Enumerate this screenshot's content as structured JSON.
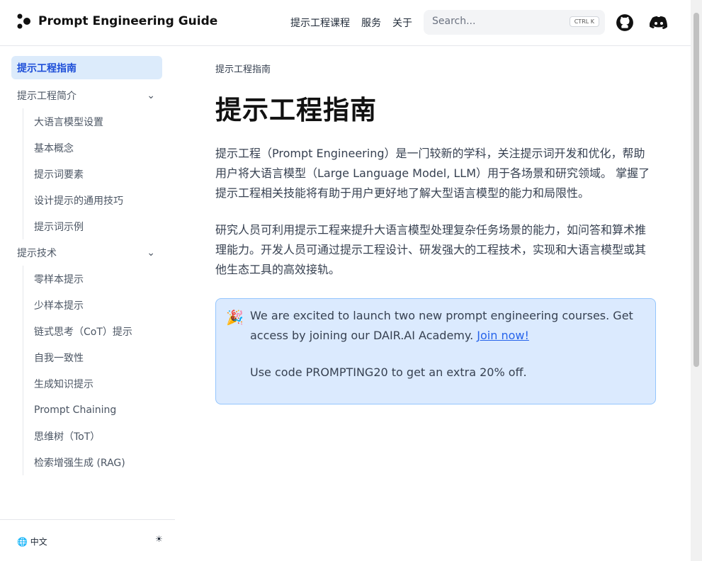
{
  "header": {
    "title": "Prompt Engineering Guide",
    "nav": [
      "提示工程课程",
      "服务",
      "关于"
    ],
    "search_placeholder": "Search...",
    "search_kbd": "CTRL K"
  },
  "sidebar": {
    "items": [
      {
        "label": "提示工程指南",
        "type": "active"
      },
      {
        "label": "提示工程简介",
        "type": "section"
      },
      {
        "label": "大语言模型设置",
        "type": "sub"
      },
      {
        "label": "基本概念",
        "type": "sub"
      },
      {
        "label": "提示词要素",
        "type": "sub"
      },
      {
        "label": "设计提示的通用技巧",
        "type": "sub"
      },
      {
        "label": "提示词示例",
        "type": "sub"
      },
      {
        "label": "提示技术",
        "type": "section"
      },
      {
        "label": "零样本提示",
        "type": "sub"
      },
      {
        "label": "少样本提示",
        "type": "sub"
      },
      {
        "label": "链式思考（CoT）提示",
        "type": "sub"
      },
      {
        "label": "自我一致性",
        "type": "sub"
      },
      {
        "label": "生成知识提示",
        "type": "sub"
      },
      {
        "label": "Prompt Chaining",
        "type": "sub"
      },
      {
        "label": "思维树（ToT）",
        "type": "sub"
      },
      {
        "label": "检索增强生成 (RAG)",
        "type": "sub"
      }
    ],
    "language": "中文"
  },
  "main": {
    "breadcrumb": "提示工程指南",
    "title": "提示工程指南",
    "paragraphs": [
      "提示工程（Prompt Engineering）是一门较新的学科，关注提示词开发和优化，帮助用户将大语言模型（Large Language Model, LLM）用于各场景和研究领域。 掌握了提示工程相关技能将有助于用户更好地了解大型语言模型的能力和局限性。",
      "研究人员可利用提示工程来提升大语言模型处理复杂任务场景的能力，如问答和算术推理能力。开发人员可通过提示工程设计、研发强大的工程技术，实现和大语言模型或其他生态工具的高效接轨。"
    ],
    "callout": {
      "text": "We are excited to launch two new prompt engineering courses. Get access by joining our DAIR.AI Academy.",
      "link": "Join now!",
      "code_text": "Use code PROMPTING20 to get an extra 20% off."
    }
  }
}
